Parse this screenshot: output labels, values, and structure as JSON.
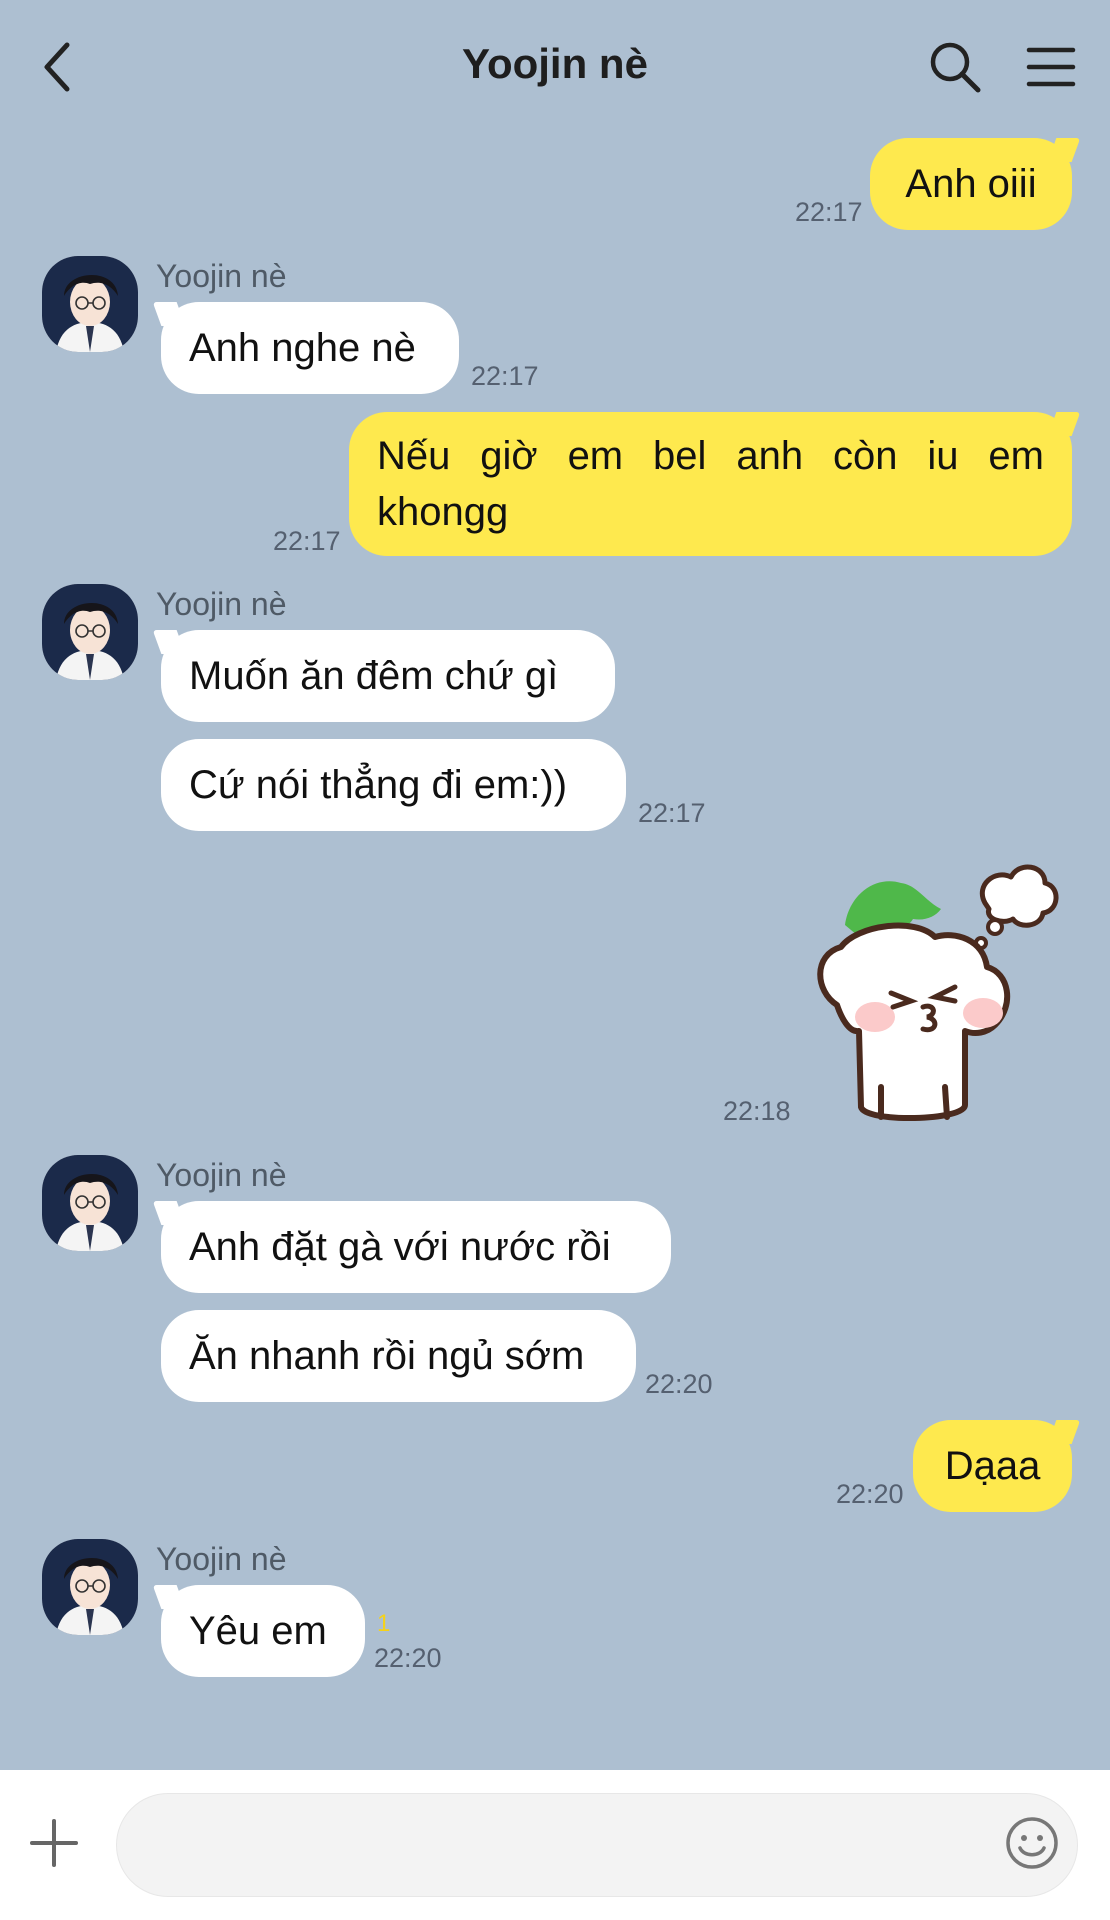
{
  "header": {
    "title": "Yoojin nè",
    "back_icon": "chevron-left-icon",
    "search_icon": "search-icon",
    "menu_icon": "hamburger-menu-icon"
  },
  "contact": {
    "name": "Yoojin nè"
  },
  "messages": [
    {
      "from": "me",
      "text": "Anh oiii",
      "time": "22:17"
    },
    {
      "from": "Yoojin nè",
      "texts": [
        "Anh nghe nè"
      ],
      "time": "22:17"
    },
    {
      "from": "me",
      "lines": [
        "Nếu giờ em bel anh còn iu em",
        "khongg"
      ],
      "time": "22:17"
    },
    {
      "from": "Yoojin nè",
      "texts": [
        "Muốn ăn đêm chứ gì",
        "Cứ nói thẳng đi em:))"
      ],
      "time": "22:17"
    },
    {
      "from": "me",
      "sticker": "radish-kiss-sticker",
      "time": "22:18"
    },
    {
      "from": "Yoojin nè",
      "texts": [
        "Anh đặt gà với nước rồi",
        "Ăn nhanh rồi ngủ sớm"
      ],
      "time": "22:20"
    },
    {
      "from": "me",
      "text": "Dạaa",
      "time": "22:20"
    },
    {
      "from": "Yoojin nè",
      "texts": [
        "Yêu em"
      ],
      "time": "22:20",
      "unread": "1"
    }
  ],
  "input": {
    "placeholder": "",
    "plus_icon": "plus-icon",
    "emoji_icon": "emoji-icon"
  },
  "colors": {
    "background": "#ADBFD1",
    "outgoing": "#FEE94E",
    "incoming": "#FFFFFF",
    "unread": "#F5D21A"
  }
}
